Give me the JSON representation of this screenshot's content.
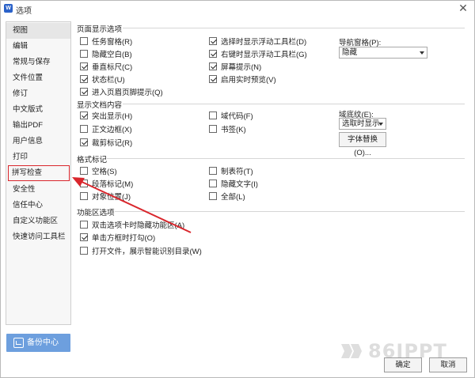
{
  "window": {
    "title": "选项",
    "app_icon_letter": "W"
  },
  "sidebar": {
    "items": [
      {
        "label": "视图"
      },
      {
        "label": "编辑"
      },
      {
        "label": "常规与保存"
      },
      {
        "label": "文件位置"
      },
      {
        "label": "修订"
      },
      {
        "label": "中文版式"
      },
      {
        "label": "输出PDF"
      },
      {
        "label": "用户信息"
      },
      {
        "label": "打印"
      },
      {
        "label": "拼写检查"
      },
      {
        "label": "安全性"
      },
      {
        "label": "信任中心"
      },
      {
        "label": "自定义功能区"
      },
      {
        "label": "快速访问工具栏"
      }
    ],
    "active_item": "视图",
    "highlighted_item": "拼写检查"
  },
  "backup": {
    "label": "备份中心"
  },
  "page_display": {
    "title": "页面显示选项",
    "checkboxes": [
      {
        "label": "任务窗格(R)",
        "checked": false
      },
      {
        "label": "隐藏空白(B)",
        "checked": false
      },
      {
        "label": "垂直标尺(C)",
        "checked": true
      },
      {
        "label": "状态栏(U)",
        "checked": true
      },
      {
        "label": "进入页眉页脚提示(Q)",
        "checked": true
      },
      {
        "label": "选择时显示浮动工具栏(D)",
        "checked": true
      },
      {
        "label": "右键时显示浮动工具栏(G)",
        "checked": true
      },
      {
        "label": "屏幕提示(N)",
        "checked": true
      },
      {
        "label": "启用实时预览(V)",
        "checked": true
      }
    ],
    "nav_pane_label": "导航窗格(P):",
    "nav_pane_value": "隐藏"
  },
  "doc_content": {
    "title": "显示文档内容",
    "checkboxes": [
      {
        "label": "突出显示(H)",
        "checked": true
      },
      {
        "label": "正文边框(X)",
        "checked": false
      },
      {
        "label": "裁剪标记(R)",
        "checked": true
      },
      {
        "label": "域代码(F)",
        "checked": false
      },
      {
        "label": "书签(K)",
        "checked": false
      }
    ],
    "shading_label": "域底纹(E):",
    "shading_value": "选取时显示",
    "font_replace_button": "字体替换(O)..."
  },
  "format_marks": {
    "title": "格式标记",
    "checkboxes": [
      {
        "label": "空格(S)",
        "checked": false
      },
      {
        "label": "段落标记(M)",
        "checked": false
      },
      {
        "label": "对象位置(J)",
        "checked": false
      },
      {
        "label": "制表符(T)",
        "checked": false
      },
      {
        "label": "隐藏文字(I)",
        "checked": false
      },
      {
        "label": "全部(L)",
        "checked": false
      }
    ]
  },
  "ribbon_options": {
    "title": "功能区选项",
    "checkboxes": [
      {
        "label": "双击选项卡时隐藏功能区(A)",
        "checked": false
      },
      {
        "label": "单击方框时打勾(O)",
        "checked": true
      },
      {
        "label": "打开文件，展示智能识别目录(W)",
        "checked": false
      }
    ]
  },
  "footer": {
    "ok_label": "确定",
    "cancel_label": "取消"
  },
  "watermark": {
    "text": "86IPPT"
  },
  "colors": {
    "highlight_border": "#d9262c",
    "arrow": "#d9262c",
    "backup_bg": "#6d9fde"
  }
}
